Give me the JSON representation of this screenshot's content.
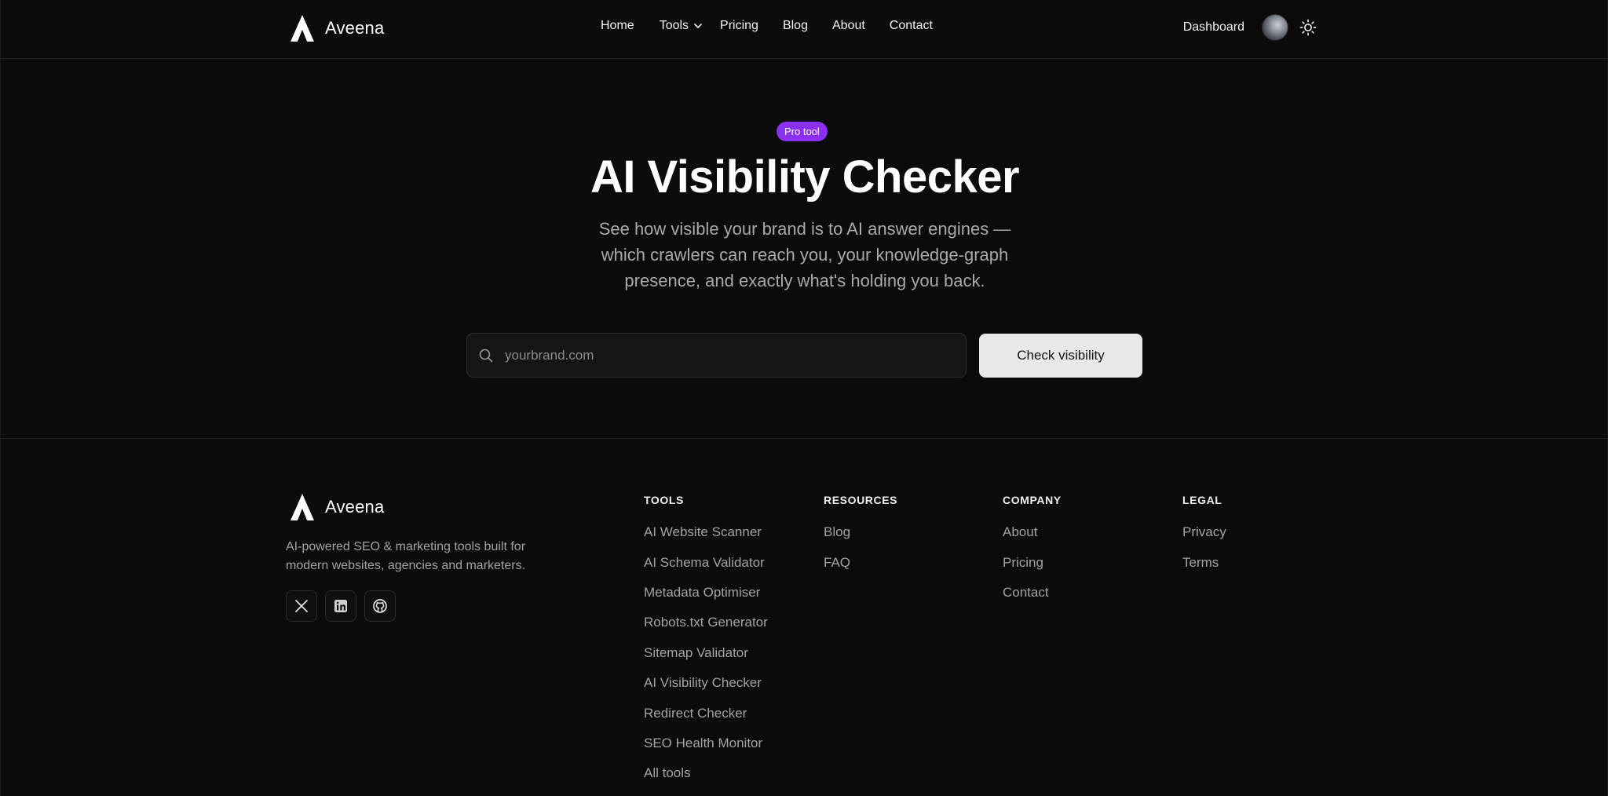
{
  "header": {
    "brand": "Aveena",
    "nav": [
      {
        "label": "Home"
      },
      {
        "label": "Tools"
      },
      {
        "label": "Pricing"
      },
      {
        "label": "Blog"
      },
      {
        "label": "About"
      },
      {
        "label": "Contact"
      }
    ],
    "dashboard_label": "Dashboard"
  },
  "hero": {
    "badge": "Pro tool",
    "title": "AI Visibility Checker",
    "subtitle": "See how visible your brand is to AI answer engines — which crawlers can reach you, your knowledge-graph presence, and exactly what's holding you back.",
    "search_placeholder": "yourbrand.com",
    "button_label": "Check visibility"
  },
  "footer": {
    "brand": "Aveena",
    "tagline": "AI-powered SEO & marketing tools built for modern websites, agencies and marketers.",
    "columns": [
      {
        "title": "TOOLS",
        "links": [
          "AI Website Scanner",
          "AI Schema Validator",
          "Metadata Optimiser",
          "Robots.txt Generator",
          "Sitemap Validator",
          "AI Visibility Checker",
          "Redirect Checker",
          "SEO Health Monitor",
          "All tools"
        ]
      },
      {
        "title": "RESOURCES",
        "links": [
          "Blog",
          "FAQ"
        ]
      },
      {
        "title": "COMPANY",
        "links": [
          "About",
          "Pricing",
          "Contact"
        ]
      },
      {
        "title": "LEGAL",
        "links": [
          "Privacy",
          "Terms"
        ]
      }
    ],
    "socials": [
      "x-icon",
      "linkedin-icon",
      "github-icon"
    ]
  },
  "colors": {
    "background": "#0b0b0b",
    "badge": "#8b2ff0",
    "button": "#e8e8e8",
    "muted_text": "#a3a3a3"
  }
}
